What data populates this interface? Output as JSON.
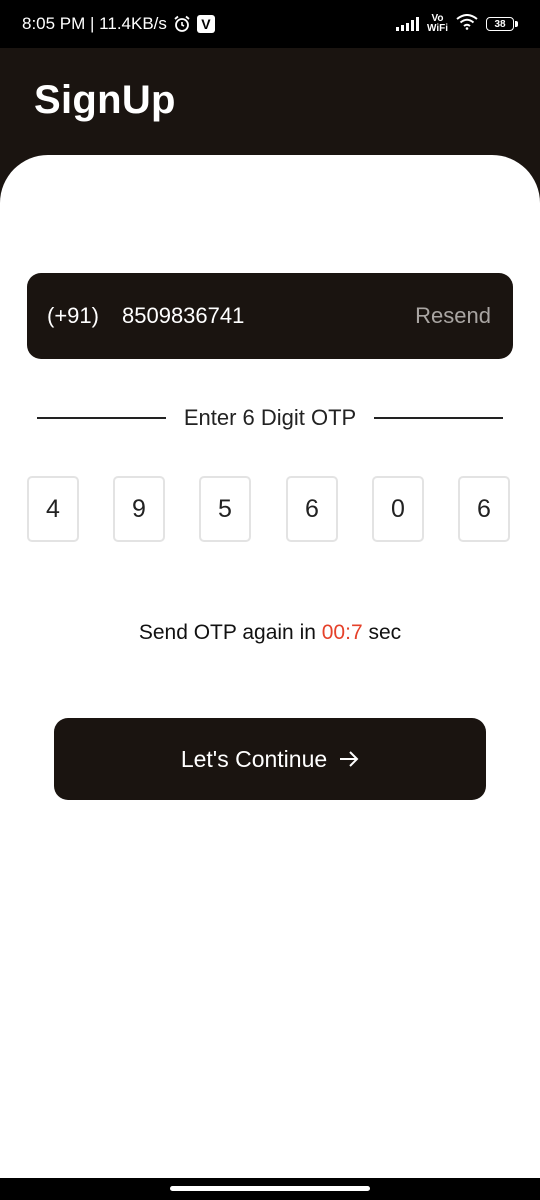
{
  "status_bar": {
    "time_speed": "8:05 PM | 11.4KB/s",
    "v_badge": "V",
    "vowifi_top": "Vo",
    "vowifi_bottom": "WiFi",
    "battery": "38",
    "icons": [
      "alarm-icon",
      "v-app-icon",
      "signal-icon",
      "vowifi-icon",
      "wifi-icon",
      "battery-icon"
    ]
  },
  "header": {
    "title": "SignUp"
  },
  "phone": {
    "country_code": "(+91)",
    "number": "8509836741",
    "resend_label": "Resend"
  },
  "otp": {
    "divider_label": "Enter 6 Digit OTP",
    "digits": [
      "4",
      "9",
      "5",
      "6",
      "0",
      "6"
    ]
  },
  "timer": {
    "prefix": "Send OTP again in ",
    "value": "00:7",
    "suffix": " sec"
  },
  "continue_button": {
    "label": "Let's Continue",
    "icon": "arrow-right-icon"
  },
  "colors": {
    "primary_dark": "#1a1410",
    "timer_red": "#e5412a",
    "resend_gray": "#a9a5a2"
  }
}
